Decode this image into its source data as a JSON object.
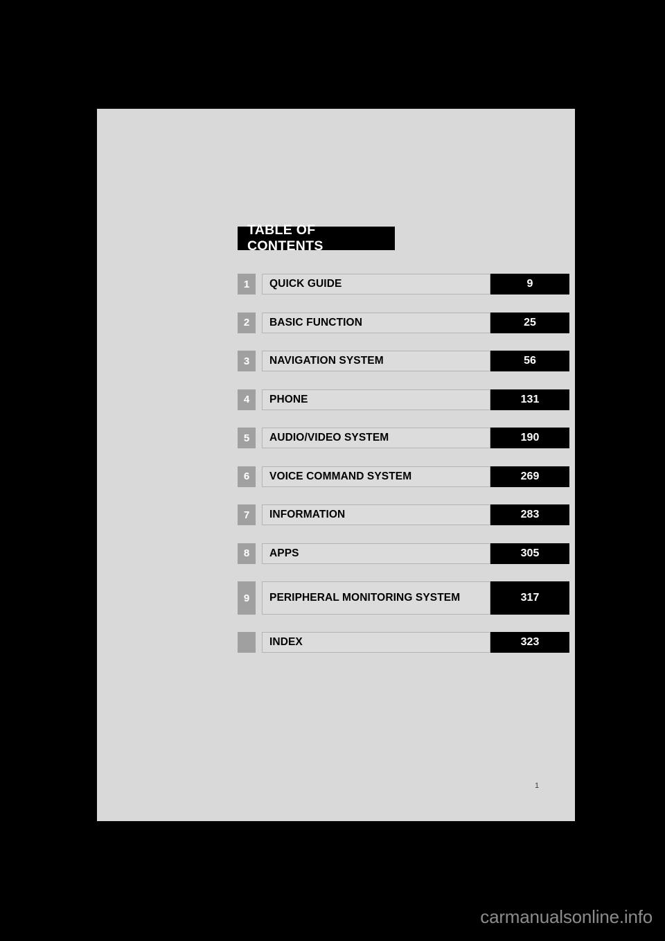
{
  "document": {
    "banner_title": "TABLE OF CONTENTS",
    "folio": "1",
    "watermark": "carmanualsonline.info",
    "colors": {
      "page_background": "#d9d9d9",
      "banner_background": "#000000",
      "badge_background": "#a0a0a0",
      "entry_field_background": "#dcdcdc",
      "entry_field_border": "#b4b4b4",
      "page_number_background": "#000000",
      "outside_background": "#000000",
      "watermark_text": "#8c8c8c"
    }
  },
  "contents": [
    {
      "chapter": "1",
      "title": "QUICK GUIDE",
      "page": "9"
    },
    {
      "chapter": "2",
      "title": "BASIC FUNCTION",
      "page": "25"
    },
    {
      "chapter": "3",
      "title": "NAVIGATION SYSTEM",
      "page": "56"
    },
    {
      "chapter": "4",
      "title": "PHONE",
      "page": "131"
    },
    {
      "chapter": "5",
      "title": "AUDIO/VIDEO SYSTEM",
      "page": "190"
    },
    {
      "chapter": "6",
      "title": "VOICE COMMAND SYSTEM",
      "page": "269"
    },
    {
      "chapter": "7",
      "title": "INFORMATION",
      "page": "283"
    },
    {
      "chapter": "8",
      "title": "APPS",
      "page": "305"
    },
    {
      "chapter": "9",
      "title": "PERIPHERAL MONITORING SYSTEM",
      "page": "317"
    },
    {
      "chapter": "",
      "title": "INDEX",
      "page": "323"
    }
  ]
}
